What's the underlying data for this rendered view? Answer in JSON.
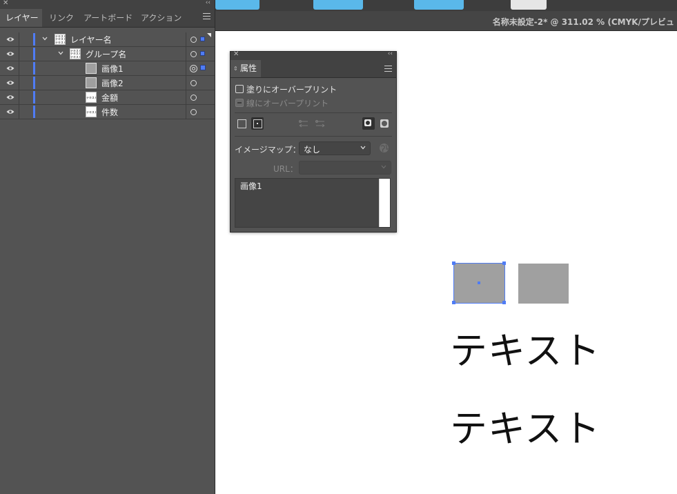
{
  "window": {
    "document_title": "名称未設定-2* @ 311.02 % (CMYK/プレビュ"
  },
  "layers_panel": {
    "tabs": [
      {
        "label": "レイヤー",
        "active": true
      },
      {
        "label": "リンク",
        "active": false
      },
      {
        "label": "アートボード",
        "active": false
      },
      {
        "label": "アクション",
        "active": false
      }
    ],
    "rows": [
      {
        "name": "レイヤー名",
        "thumb_text": "テキスト\nテキスト\nテキスト"
      },
      {
        "name": "グループ名",
        "thumb_text": "テキスト\nテキスト\nテキスト"
      },
      {
        "name": "画像1"
      },
      {
        "name": "画像2"
      },
      {
        "name": "金額",
        "thumb_text": "テキスト"
      },
      {
        "name": "件数",
        "thumb_text": "テキスト"
      }
    ]
  },
  "attributes_panel": {
    "tab_label": "属性",
    "fill_overprint_label": "塗りにオーバープリント",
    "stroke_overprint_label": "線にオーバープリント",
    "image_map_label": "イメージマップ：",
    "image_map_value": "なし",
    "url_label": "URL：",
    "url_value": "",
    "note_text": "画像1"
  },
  "canvas": {
    "text_1": "テキスト",
    "text_2": "テキスト"
  },
  "colors": {
    "accent_blue": "#4f7cf5",
    "panel_bg": "#535353",
    "chip_blue": "#5ab8ea"
  }
}
